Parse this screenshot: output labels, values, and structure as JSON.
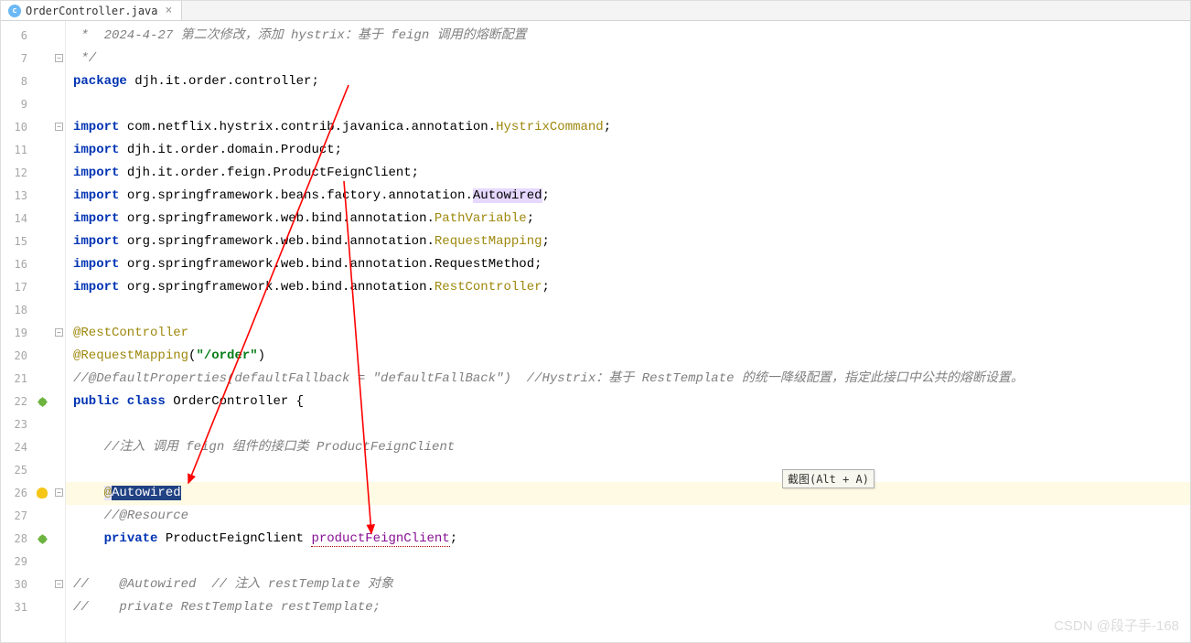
{
  "tab": {
    "filename": "OrderController.java",
    "icon_letter": "c"
  },
  "tooltip": "截图(Alt + A)",
  "watermark": "CSDN @段子手-168",
  "lines": [
    {
      "n": 6,
      "html": "<span class='cm'> *  2024-4-27 第二次修改，添加 hystrix：基于 feign 调用的熔断配置</span>"
    },
    {
      "n": 7,
      "html": "<span class='cm'> */</span>",
      "fold": "-"
    },
    {
      "n": 8,
      "html": "<span class='kw'>package</span> djh.it.order.controller;"
    },
    {
      "n": 9,
      "html": ""
    },
    {
      "n": 10,
      "html": "<span class='kw'>import</span> com.netflix.hystrix.contrib.javanica.annotation.<span class='ann'>HystrixCommand</span>;",
      "fold": "-"
    },
    {
      "n": 11,
      "html": "<span class='kw'>import</span> djh.it.order.domain.Product;"
    },
    {
      "n": 12,
      "html": "<span class='kw'>import</span> djh.it.order.feign.ProductFeignClient;"
    },
    {
      "n": 13,
      "html": "<span class='kw'>import</span> org.springframework.beans.factory.annotation.<span class='hlbox'>Autowired</span>;"
    },
    {
      "n": 14,
      "html": "<span class='kw'>import</span> org.springframework.web.bind.annotation.<span class='ann'>PathVariable</span>;"
    },
    {
      "n": 15,
      "html": "<span class='kw'>import</span> org.springframework.web.bind.annotation.<span class='ann'>RequestMapping</span>;"
    },
    {
      "n": 16,
      "html": "<span class='kw'>import</span> org.springframework.web.bind.annotation.RequestMethod;"
    },
    {
      "n": 17,
      "html": "<span class='kw'>import</span> org.springframework.web.bind.annotation.<span class='ann'>RestController</span>;"
    },
    {
      "n": 18,
      "html": ""
    },
    {
      "n": 19,
      "html": "<span class='ann'>@RestController</span>",
      "fold": "-"
    },
    {
      "n": 20,
      "html": "<span class='ann'>@RequestMapping</span>(<span class='str'>\"/order\"</span>)"
    },
    {
      "n": 21,
      "html": "<span class='cm'>//@DefaultProperties(defaultFallback = \"defaultFallBack\")  //Hystrix：基于 RestTemplate 的统一降级配置，指定此接口中公共的熔断设置。</span>"
    },
    {
      "n": 22,
      "html": "<span class='kw'>public class</span> <span class='cls'>OrderController</span> {",
      "icon": "leaf"
    },
    {
      "n": 23,
      "html": ""
    },
    {
      "n": 24,
      "html": "    <span class='cm'>//注入 调用 feign 组件的接口类 ProductFeignClient</span>"
    },
    {
      "n": 25,
      "html": ""
    },
    {
      "n": 26,
      "html": "    <span class='ann-sel'>@</span><span class='sel'>Autowired</span>",
      "hl": true,
      "icon": "bulb",
      "fold": "-"
    },
    {
      "n": 27,
      "html": "    <span class='cm'>//@Resource</span>"
    },
    {
      "n": 28,
      "html": "    <span class='kw'>private</span> ProductFeignClient <span class='field fld-under'>productFeignClient</span>;",
      "icon": "leaf"
    },
    {
      "n": 29,
      "html": ""
    },
    {
      "n": 30,
      "html": "<span class='cm'>//    @Autowired  // 注入 restTemplate 对象</span>",
      "fold": "-"
    },
    {
      "n": 31,
      "html": "<span class='cm'>//    private RestTemplate restTemplate;</span>"
    }
  ]
}
